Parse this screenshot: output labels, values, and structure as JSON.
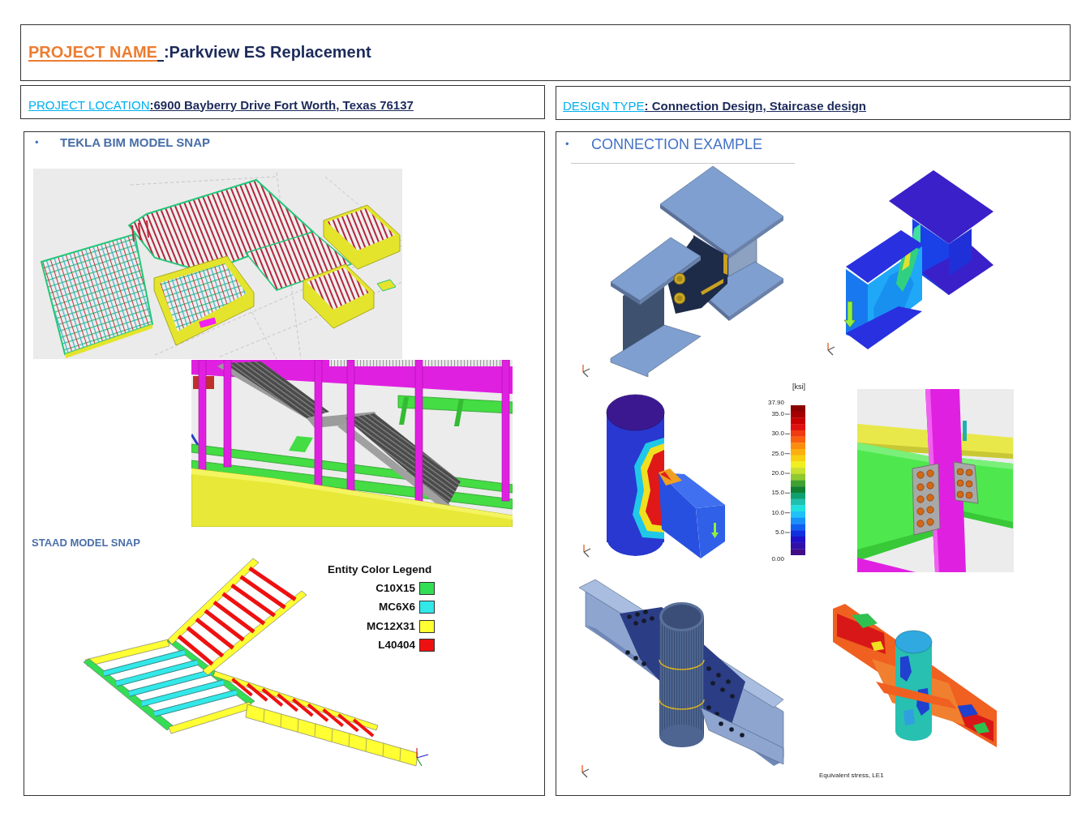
{
  "header": {
    "label": "PROJECT NAME",
    "value": ":Parkview ES Replacement"
  },
  "info_boxes": [
    {
      "label": "PROJECT LOCATION",
      "value": ":6900 Bayberry Drive Fort Worth, Texas 76137"
    },
    {
      "label": "DESIGN TYPE",
      "value": ": Connection Design, Staircase design"
    }
  ],
  "left_panel": {
    "bullet": "•",
    "title": "TEKLA BIM MODEL SNAP",
    "staad_title": "STAAD MODEL SNAP",
    "legend": {
      "title": "Entity Color Legend",
      "items": [
        {
          "label": "C10X15",
          "color": "#33dd55"
        },
        {
          "label": "MC6X6",
          "color": "#33e8e8"
        },
        {
          "label": "MC12X31",
          "color": "#ffff33"
        },
        {
          "label": "L40404",
          "color": "#ee1111"
        }
      ]
    }
  },
  "right_panel": {
    "bullet": "•",
    "title": "CONNECTION EXAMPLE",
    "color_scale": {
      "unit": "[ksi]",
      "ticks": [
        "37.90",
        "35.0",
        "30.0",
        "25.0",
        "20.0",
        "15.0",
        "10.0",
        "5.0",
        "0.00"
      ]
    },
    "caption": "Equivalent stress, LE1"
  }
}
